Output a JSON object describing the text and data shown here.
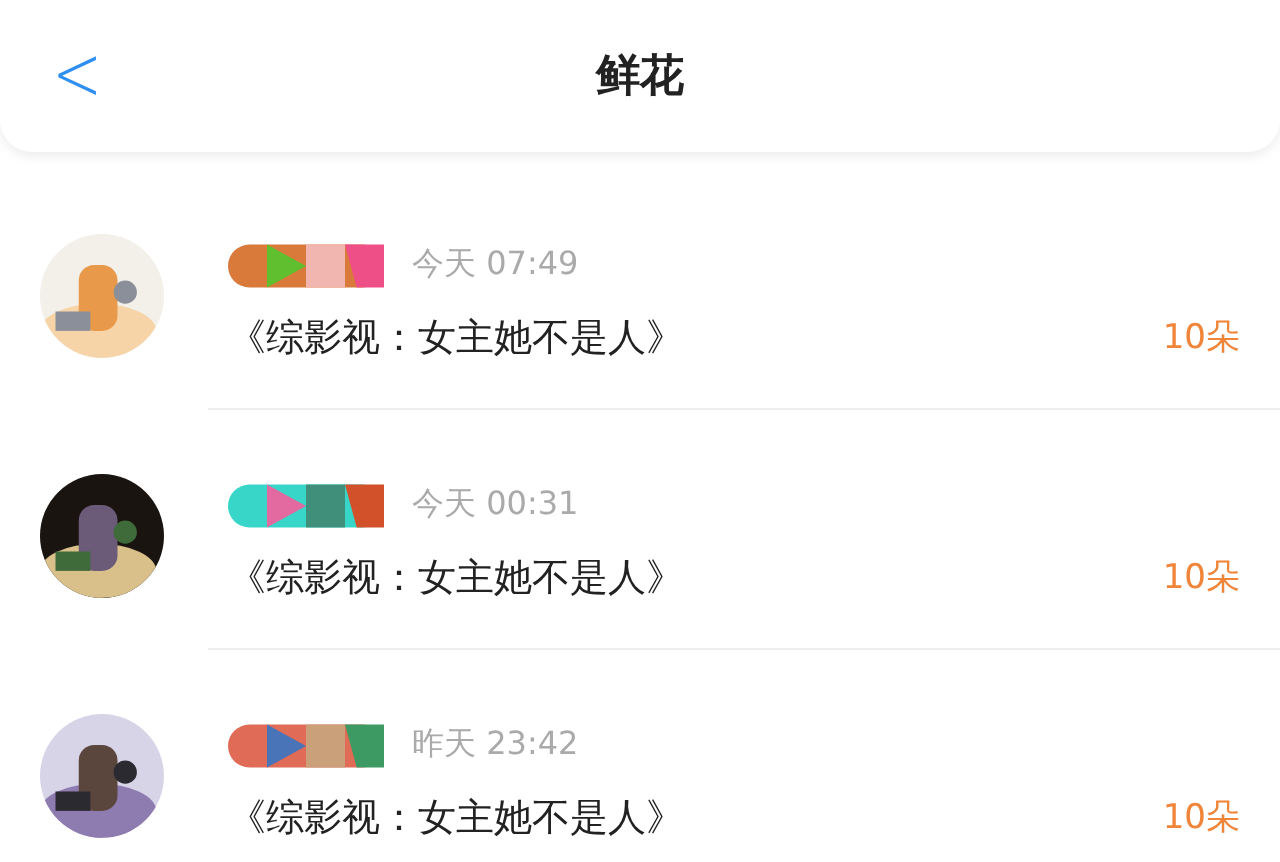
{
  "header": {
    "back": "<",
    "title": "鲜花"
  },
  "items": [
    {
      "time": "今天 07:49",
      "book": "《综影视：女主她不是人》",
      "amount": "10朵"
    },
    {
      "time": "今天 00:31",
      "book": "《综影视：女主她不是人》",
      "amount": "10朵"
    },
    {
      "time": "昨天 23:42",
      "book": "《综影视：女主她不是人》",
      "amount": "10朵"
    }
  ]
}
